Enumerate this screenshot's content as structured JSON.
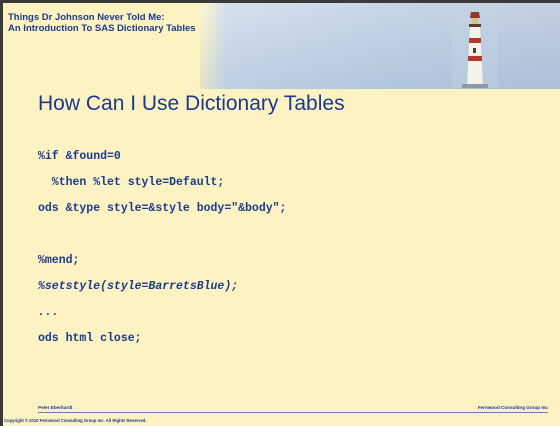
{
  "header": {
    "title_line1": "Things Dr Johnson Never Told Me:",
    "title_line2": "An Introduction To SAS Dictionary Tables"
  },
  "slide": {
    "title": "How Can I Use Dictionary Tables"
  },
  "code": [
    "%if &found=0",
    "  %then %let style=Default;",
    "ods &type style=&style body=\"&body\";",
    "%mend;",
    "%setstyle(style=BarretsBlue);",
    "...",
    "ods html close;"
  ],
  "footer": {
    "author": "Peter Eberhardt",
    "company": "Fernwood Consulting Group Inc",
    "copyright": "Copyright © 2010 Fernwood Consulting Group Inc. All Rights Reserved."
  },
  "colors": {
    "background": "#fdf2c2",
    "text": "#1b3a8f",
    "header_sky": "#b4c9de"
  },
  "icons": {
    "header_image": "lighthouse-icon"
  }
}
